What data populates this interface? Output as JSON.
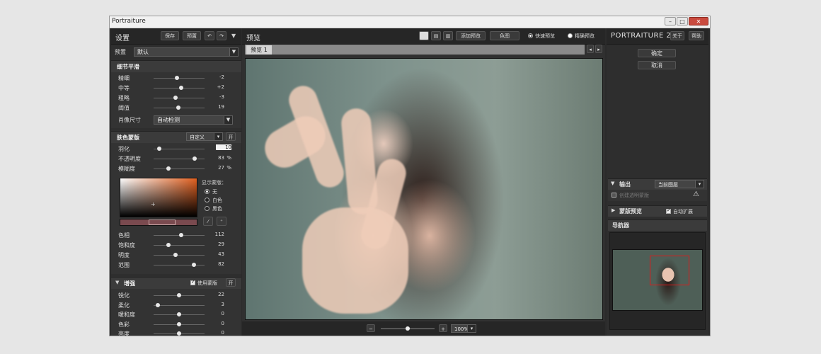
{
  "window": {
    "title": "Portraiture"
  },
  "left": {
    "header": {
      "title": "设置",
      "save": "保存",
      "reset": "预置"
    },
    "preset": {
      "label": "预置",
      "value": "默认"
    },
    "detail": {
      "title": "细节平滑",
      "rows": [
        {
          "label": "精细",
          "value": "-2",
          "level": 0.45
        },
        {
          "label": "中等",
          "value": "+2",
          "level": 0.55
        },
        {
          "label": "粗略",
          "value": "-3",
          "level": 0.42
        },
        {
          "label": "阈值",
          "value": "19",
          "level": 0.48
        }
      ],
      "size_label": "肖像尺寸",
      "size_value": "自动检测"
    },
    "skin": {
      "title": "肤色蒙版",
      "mode": "自定义",
      "toggle": "开",
      "rows": [
        {
          "label": "羽化",
          "value": "10",
          "unit": "",
          "level": 0.08
        },
        {
          "label": "不透明度",
          "value": "83",
          "unit": "%",
          "level": 0.83
        },
        {
          "label": "模糊度",
          "value": "27",
          "unit": "%",
          "level": 0.27
        }
      ],
      "show_mask_label": "显示蒙版：",
      "mask_options": [
        "无",
        "白色",
        "黑色"
      ],
      "hsl": [
        {
          "label": "色相",
          "value": "112",
          "level": 0.55
        },
        {
          "label": "饱和度",
          "value": "29",
          "level": 0.28
        },
        {
          "label": "明度",
          "value": "43",
          "level": 0.42
        },
        {
          "label": "范围",
          "value": "82",
          "level": 0.82
        }
      ]
    },
    "enhance": {
      "title": "增强",
      "use_mask": "使用蒙版",
      "toggle": "开",
      "rows": [
        {
          "label": "锐化",
          "value": "22",
          "level": 0.5
        },
        {
          "label": "柔化",
          "value": "3",
          "level": 0.05
        },
        {
          "label": "暖和度",
          "value": "0",
          "level": 0.5
        },
        {
          "label": "色彩",
          "value": "0",
          "level": 0.5
        },
        {
          "label": "亮度",
          "value": "0",
          "level": 0.5
        }
      ]
    }
  },
  "center": {
    "header": {
      "title": "预览",
      "add_preview": "添加预览",
      "compare": "色图",
      "fast_preview": "快速预览",
      "accurate_preview": "精确预览"
    },
    "tab": "预览 1",
    "zoom": "100%"
  },
  "right": {
    "brand": "PORTRAITURE 2",
    "about": "关于",
    "help": "帮助",
    "ok": "确定",
    "cancel": "取消",
    "output": {
      "label": "输出",
      "value": "当前图层",
      "new_layer": "创建透明蒙版"
    },
    "mask_preview": {
      "label": "蒙版预览",
      "auto": "自动扩展"
    },
    "navigator": "导航器"
  },
  "colors": {
    "accent": "#e06020",
    "nav_rect": "#e01a1a"
  }
}
